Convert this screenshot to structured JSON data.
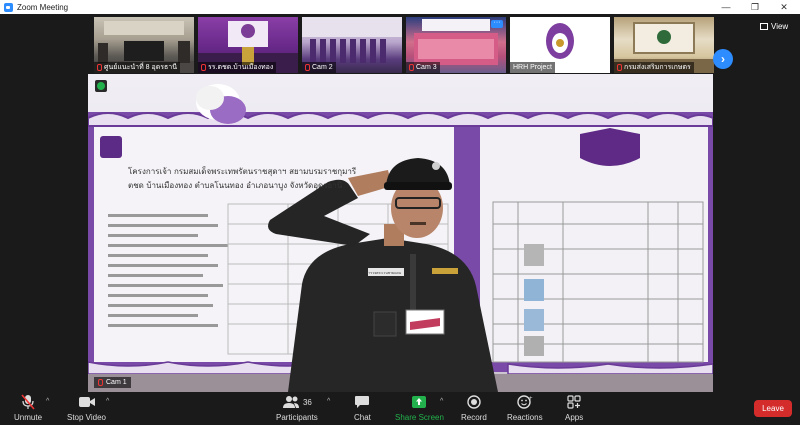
{
  "window": {
    "title": "Zoom Meeting"
  },
  "thumbnails": [
    {
      "name": "ศูนย์แนะนำที่ 8 อุดรธานี",
      "muted": true
    },
    {
      "name": "รร.ตชด.บ้านเมืองทอง",
      "muted": true
    },
    {
      "name": "Cam 2",
      "muted": true
    },
    {
      "name": "Cam 3",
      "muted": true
    },
    {
      "name": "HRH Project",
      "muted": false
    },
    {
      "name": "กรมส่งเสริมการเกษตร",
      "muted": true
    }
  ],
  "view_button": {
    "label": "View"
  },
  "main_video": {
    "speaker": "Cam 1",
    "poster_heading_line1": "โครงการเจ้า กรมสมเด็จพระเทพรัตนราชสุดาฯ สยามบรมราชกุมารี",
    "poster_heading_line2": "ตชด บ้านเมืองทอง ตำบลโนนทอง อำเภอนาบูง จังหวัดอุดรธานี",
    "patch_text": "ตำรวจตระเวนชายแดน"
  },
  "toolbar": {
    "unmute": "Unmute",
    "stop_video": "Stop Video",
    "participants": "Participants",
    "participants_count": "36",
    "chat": "Chat",
    "share_screen": "Share Screen",
    "record": "Record",
    "reactions": "Reactions",
    "apps": "Apps",
    "leave": "Leave"
  },
  "colors": {
    "zoom_blue": "#2d8cff",
    "share_green": "#22b14c",
    "leave_red": "#d42b2b",
    "toolbar_bg": "#1a1a1a"
  }
}
